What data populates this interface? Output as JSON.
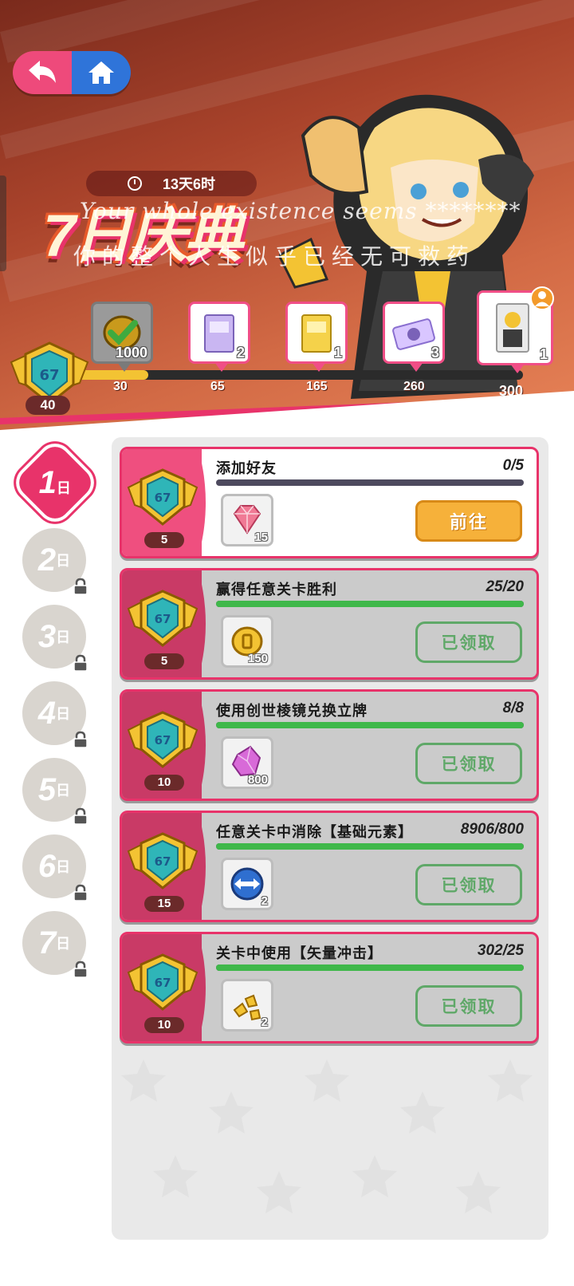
{
  "header": {
    "timer": "13天6时",
    "event_title": "7日庆典",
    "subtitle_en": "Your whole existence seems ********",
    "subtitle_cn": "你的整个人生似乎已经无可救药",
    "badge_points": "40",
    "progress_fraction": 0.16
  },
  "milestones": [
    {
      "threshold": "30",
      "qty": "1000",
      "item": "coin",
      "claimed": true
    },
    {
      "threshold": "65",
      "qty": "2",
      "item": "purple-pack"
    },
    {
      "threshold": "165",
      "qty": "1",
      "item": "gold-pack"
    },
    {
      "threshold": "260",
      "qty": "3",
      "item": "ticket"
    },
    {
      "threshold": "300",
      "qty": "1",
      "item": "character-card"
    }
  ],
  "days": [
    {
      "num": "1",
      "suffix": "日",
      "active": true
    },
    {
      "num": "2",
      "suffix": "日",
      "locked": true
    },
    {
      "num": "3",
      "suffix": "日",
      "locked": true
    },
    {
      "num": "4",
      "suffix": "日",
      "locked": true
    },
    {
      "num": "5",
      "suffix": "日",
      "locked": true
    },
    {
      "num": "6",
      "suffix": "日",
      "locked": true
    },
    {
      "num": "7",
      "suffix": "日",
      "locked": true
    }
  ],
  "tasks": [
    {
      "title": "添加好友",
      "progress": "0/5",
      "fraction": 0.0,
      "points": "5",
      "reward_qty": "15",
      "reward": "gem",
      "button": "前往",
      "status": "go"
    },
    {
      "title": "赢得任意关卡胜利",
      "progress": "25/20",
      "fraction": 1.0,
      "points": "5",
      "reward_qty": "150",
      "reward": "coin",
      "button": "已领取",
      "status": "claimed"
    },
    {
      "title": "使用创世棱镜兑换立牌",
      "progress": "8/8",
      "fraction": 1.0,
      "points": "10",
      "reward_qty": "800",
      "reward": "pink-crystal",
      "button": "已领取",
      "status": "claimed"
    },
    {
      "title": "任意关卡中消除【基础元素】",
      "progress": "8906/800",
      "fraction": 1.0,
      "points": "15",
      "reward_qty": "2",
      "reward": "swap-tool",
      "button": "已领取",
      "status": "claimed"
    },
    {
      "title": "关卡中使用【矢量冲击】",
      "progress": "302/25",
      "fraction": 1.0,
      "points": "10",
      "reward_qty": "2",
      "reward": "gold-shards",
      "button": "已领取",
      "status": "claimed"
    }
  ],
  "colors": {
    "accent": "#e8336a",
    "go_button": "#f6b13a",
    "claimed": "#5fa868",
    "bar_fill": "#3fb84a"
  }
}
